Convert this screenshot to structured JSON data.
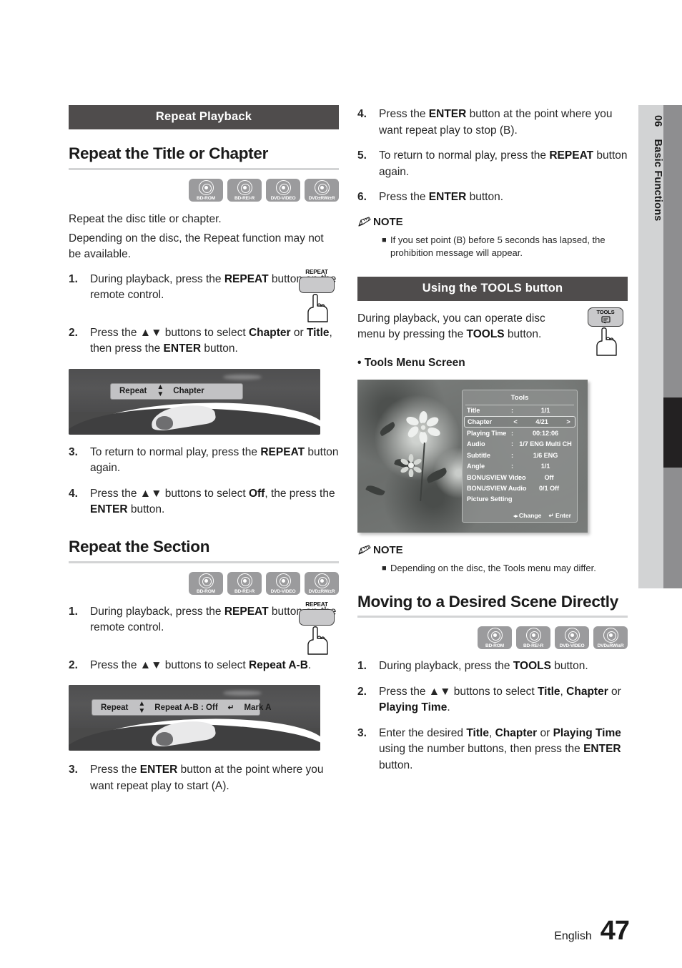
{
  "chapter_tab": {
    "number": "06",
    "name": "Basic Functions"
  },
  "footer": {
    "language": "English",
    "page": "47"
  },
  "disc_labels": [
    "BD-ROM",
    "BD-RE/-R",
    "DVD-VIDEO",
    "DVD±RW/±R"
  ],
  "left": {
    "section_bar": "Repeat Playback",
    "heading_1": "Repeat the Title or Chapter",
    "intro_line_1": "Repeat the disc title or chapter.",
    "intro_line_2": "Depending on the disc, the Repeat function may not be available.",
    "steps_1": [
      {
        "n": "1.",
        "html": "During playback, press the <b>REPEAT</b> button on the remote control."
      },
      {
        "n": "2.",
        "html": "Press the ▲▼ buttons to select <b>Chapter</b> or <b>Title</b>, then press the <b>ENTER</b> button."
      },
      {
        "n": "3.",
        "html": "To return to normal play, press the <b>REPEAT</b> button again."
      },
      {
        "n": "4.",
        "html": "Press the ▲▼ buttons to select <b>Off</b>, the press the <b>ENTER</b> button."
      }
    ],
    "osd_1": {
      "label": "Repeat",
      "updown": "⬍",
      "value": "Chapter"
    },
    "heading_2": "Repeat the Section",
    "steps_2": [
      {
        "n": "1.",
        "html": "During playback, press the <b>REPEAT</b> button on the remote control."
      },
      {
        "n": "2.",
        "html": "Press the ▲▼ buttons to select <b>Repeat A-B</b>."
      },
      {
        "n": "3.",
        "html": "Press the <b>ENTER</b> button at the point where you want repeat play to start (A)."
      }
    ],
    "osd_2": {
      "label": "Repeat",
      "updown": "⬍",
      "value": "Repeat A-B : Off",
      "enter_icon": "↵",
      "mark": "Mark A"
    },
    "remote_button": "REPEAT"
  },
  "right": {
    "steps_top": [
      {
        "n": "4.",
        "html": "Press the <b>ENTER</b> button at the point where you want repeat play to stop (B)."
      },
      {
        "n": "5.",
        "html": "To return to normal play, press the <b>REPEAT</b> button again."
      },
      {
        "n": "6.",
        "html": "Press the <b>ENTER</b> button."
      }
    ],
    "note_1": {
      "title": "NOTE",
      "items": [
        "If you set point (B) before 5 seconds has lapsed, the prohibition message will appear."
      ]
    },
    "section_bar": "Using the TOOLS button",
    "tools_intro": "During playback, you can operate disc menu by pressing the <b>TOOLS</b> button.",
    "tools_button": "TOOLS",
    "bullet_heading": "• Tools Menu Screen",
    "note_2": {
      "title": "NOTE",
      "items": [
        "Depending on the disc, the Tools menu may differ."
      ]
    },
    "heading_3": "Moving to a Desired Scene Directly",
    "steps_bottom": [
      {
        "n": "1.",
        "html": "During playback, press the <b>TOOLS</b> button."
      },
      {
        "n": "2.",
        "html": "Press the ▲▼ buttons to select <b>Title</b>, <b>Chapter</b> or <b>Playing Time</b>."
      },
      {
        "n": "3.",
        "html": "Enter the desired <b>Title</b>, <b>Chapter</b> or <b>Playing Time</b> using the number buttons, then press the <b>ENTER</b> button."
      }
    ]
  },
  "tools_menu": {
    "title": "Tools",
    "rows": [
      {
        "key": "Title",
        "colon": ":",
        "value": "1/1",
        "selected": false
      },
      {
        "key": "Chapter",
        "colon": "<",
        "value": "4/21",
        "right": ">",
        "selected": true
      },
      {
        "key": "Playing Time",
        "colon": ":",
        "value": "00:12:06",
        "selected": false
      },
      {
        "key": "Audio",
        "colon": ":",
        "value": "1/7 ENG Multi CH",
        "selected": false
      },
      {
        "key": "Subtitle",
        "colon": ":",
        "value": "1/6 ENG",
        "selected": false
      },
      {
        "key": "Angle",
        "colon": ":",
        "value": "1/1",
        "selected": false
      },
      {
        "key": "BONUSVIEW Video",
        "colon": ":",
        "value": "Off",
        "selected": false
      },
      {
        "key": "BONUSVIEW Audio",
        "colon": ":",
        "value": "0/1 Off",
        "selected": false
      },
      {
        "key": "Picture Setting",
        "colon": "",
        "value": "",
        "selected": false
      }
    ],
    "footer_change": "Change",
    "footer_change_icon": "◂▸",
    "footer_enter": "Enter",
    "footer_enter_icon": "↵"
  },
  "colors": {
    "section_bar_bg": "#4f4c4c",
    "rule": "#d3d4d5",
    "disc_badge": "#9b9b9d",
    "tab_light": "#d2d3d4",
    "tab_dark": "#8e8e90",
    "tab_black": "#232122"
  }
}
